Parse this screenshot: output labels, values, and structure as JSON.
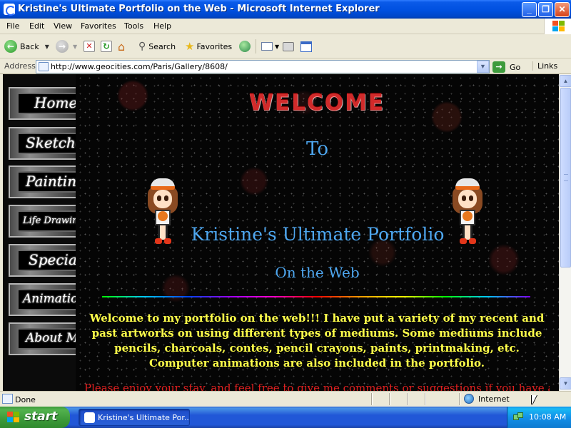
{
  "window": {
    "title": "Kristine's Ultimate Portfolio on the Web - Microsoft Internet Explorer",
    "minimize": "_",
    "maximize": "❐",
    "close": "✕"
  },
  "menu": [
    "File",
    "Edit",
    "View",
    "Favorites",
    "Tools",
    "Help"
  ],
  "toolbar": {
    "back_label": "Back",
    "search_label": "Search",
    "favorites_label": "Favorites"
  },
  "address": {
    "label": "Address",
    "url": "http://www.geocities.com/Paris/Gallery/8608/",
    "go_label": "Go",
    "links_label": "Links"
  },
  "page": {
    "nav": [
      "Home",
      "Sketches",
      "Paintings",
      "Life Drawings",
      "Specials",
      "Animations",
      "About Me"
    ],
    "welcome": "WELCOME",
    "to": "To",
    "title": "Kristine's Ultimate Portfolio",
    "subtitle": "On the Web",
    "intro": "Welcome to my portfolio on the web!!! I have put a variety of my recent and past artworks on using different types of mediums. Some mediums include pencils, charcoals, contes, pencil crayons, paints, printmaking, etc. Computer animations are also included in the portfolio.",
    "note": "Please enjoy your stay, and feel free to give me comments or suggestions if you have any."
  },
  "status": {
    "text": "Done",
    "zone": "Internet"
  },
  "taskbar": {
    "start_label": "start",
    "task_label": "Kristine's Ultimate Por...",
    "clock": "10:08 AM"
  }
}
